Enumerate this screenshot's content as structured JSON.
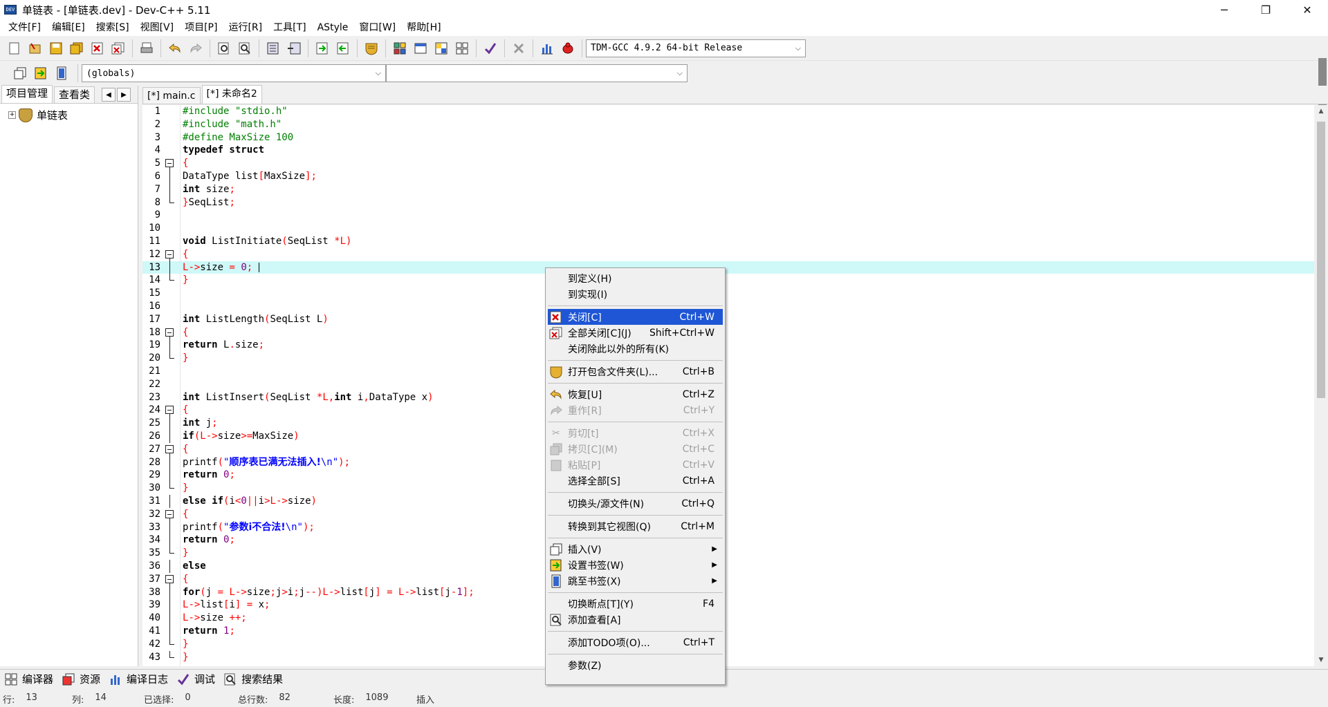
{
  "window": {
    "title": "单链表 - [单链表.dev] - Dev-C++ 5.11",
    "icon_text": "DEV",
    "minimize": "─",
    "restore": "❐",
    "close": "✕"
  },
  "menu": [
    "文件[F]",
    "编辑[E]",
    "搜索[S]",
    "视图[V]",
    "项目[P]",
    "运行[R]",
    "工具[T]",
    "AStyle",
    "窗口[W]",
    "帮助[H]"
  ],
  "toolbar": {
    "compiler_select": "TDM-GCC 4.9.2 64-bit Release",
    "scope_select": "(globals)",
    "symbol_select": ""
  },
  "left_panel": {
    "tabs": [
      "项目管理",
      "查看类"
    ],
    "nav_prev": "◀",
    "nav_next": "▶",
    "project": "单链表"
  },
  "editor_tabs": [
    "[*] main.c",
    "[*] 未命名2"
  ],
  "code_lines": [
    {
      "n": "1"
    },
    {
      "n": "2"
    },
    {
      "n": "3"
    },
    {
      "n": "4"
    },
    {
      "n": "5"
    },
    {
      "n": "6"
    },
    {
      "n": "7"
    },
    {
      "n": "8"
    },
    {
      "n": "9"
    },
    {
      "n": "10"
    },
    {
      "n": "11"
    },
    {
      "n": "12"
    },
    {
      "n": "13"
    },
    {
      "n": "14"
    },
    {
      "n": "15"
    },
    {
      "n": "16"
    },
    {
      "n": "17"
    },
    {
      "n": "18"
    },
    {
      "n": "19"
    },
    {
      "n": "20"
    },
    {
      "n": "21"
    },
    {
      "n": "22"
    },
    {
      "n": "23"
    },
    {
      "n": "24"
    },
    {
      "n": "25"
    },
    {
      "n": "26"
    },
    {
      "n": "27"
    },
    {
      "n": "28"
    },
    {
      "n": "29"
    },
    {
      "n": "30"
    },
    {
      "n": "31"
    },
    {
      "n": "32"
    },
    {
      "n": "33"
    },
    {
      "n": "34"
    },
    {
      "n": "35"
    },
    {
      "n": "36"
    },
    {
      "n": "37"
    },
    {
      "n": "38"
    },
    {
      "n": "39"
    },
    {
      "n": "40"
    },
    {
      "n": "41"
    },
    {
      "n": "42"
    },
    {
      "n": "43"
    }
  ],
  "code": {
    "l1": "#include \"stdio.h\"",
    "l2": "#include \"math.h\"",
    "l3": "#define MaxSize 100",
    "l4": "typedef struct",
    "l5": "{",
    "l6a": "DataType list",
    "l6b": "[",
    "l6c": "MaxSize",
    "l6d": "];",
    "l7a": "int",
    "l7b": " size",
    "l7c": ";",
    "l8a": "}",
    "l8b": "SeqList",
    "l8c": ";",
    "l11a": "void",
    "l11b": " ListInitiate",
    "l11c": "(",
    "l11d": "SeqList ",
    "l11e": "*",
    "l11f": "L",
    "l11g": ")",
    "l12": "{",
    "l13a": "L",
    "l13b": "->",
    "l13c": "size ",
    "l13d": "=",
    "l13e": " 0",
    "l13f": "; ",
    "l14": "}",
    "l17a": "int",
    "l17b": " ListLength",
    "l17c": "(",
    "l17d": "SeqList L",
    "l17e": ")",
    "l18": "{",
    "l19a": "return",
    "l19b": " L",
    "l19c": ".",
    "l19d": "size",
    "l19e": ";",
    "l20": "}",
    "l23a": "int",
    "l23b": " ListInsert",
    "l23c": "(",
    "l23d": "SeqList ",
    "l23e": "*",
    "l23f": "L",
    "l23g": ",",
    "l23h": "int",
    "l23i": " i",
    "l23j": ",",
    "l23k": "DataType x",
    "l23l": ")",
    "l24": "{",
    "l25a": "int",
    "l25b": " j",
    "l25c": ";",
    "l26a": "if",
    "l26b": "(",
    "l26c": "L",
    "l26d": "->",
    "l26e": "size",
    "l26f": ">=",
    "l26g": "MaxSize",
    "l26h": ")",
    "l27": "{",
    "l28a": "printf",
    "l28b": "(",
    "l28c": "\"",
    "l28d": "顺序表已满无法插入!",
    "l28e": "\\n\"",
    "l28f": ");",
    "l29a": "return",
    "l29b": " 0",
    "l29c": ";",
    "l30": "}",
    "l31a": "else if",
    "l31b": "(",
    "l31c": "i",
    "l31d": "<",
    "l31e": "0",
    "l31f": "||",
    "l31g": "i",
    "l31h": ">",
    "l31i": "L",
    "l31j": "->",
    "l31k": "size",
    "l31l": ")",
    "l32": "{",
    "l33a": "printf",
    "l33b": "(",
    "l33c": "\"",
    "l33d": "参数i不合法!",
    "l33e": "\\n\"",
    "l33f": ");",
    "l34a": "return",
    "l34b": " 0",
    "l34c": ";",
    "l35": "}",
    "l36": "else",
    "l37": "{",
    "l38a": "for",
    "l38b": "(",
    "l38c": "j ",
    "l38d": "=",
    "l38e": " L",
    "l38f": "->",
    "l38g": "size",
    "l38h": ";",
    "l38i": "j",
    "l38j": ">",
    "l38k": "i",
    "l38l": ";",
    "l38m": "j",
    "l38n": "--)",
    "l38o": "L",
    "l38p": "->",
    "l38q": "list",
    "l38r": "[",
    "l38s": "j",
    "l38t": "] = ",
    "l38u": "L",
    "l38v": "->",
    "l38w": "list",
    "l38x": "[",
    "l38y": "j",
    "l38z": "-",
    "l38aa": "1",
    "l38ab": "];",
    "l39a": "L",
    "l39b": "->",
    "l39c": "list",
    "l39d": "[",
    "l39e": "i",
    "l39f": "] = ",
    "l39g": "x",
    "l39h": ";",
    "l40a": "L",
    "l40b": "->",
    "l40c": "size ",
    "l40d": "++;",
    "l41a": "return",
    "l41b": " 1",
    "l41c": ";",
    "l42": "}",
    "l43": "}"
  },
  "context_menu": {
    "goto_def": "到定义(H)",
    "goto_impl": "到实现(I)",
    "close": "关闭[C]",
    "close_sc": "Ctrl+W",
    "close_all": "全部关闭[C](J)",
    "close_all_sc": "Shift+Ctrl+W",
    "close_others": "关闭除此以外的所有(K)",
    "open_folder": "打开包含文件夹(L)...",
    "open_folder_sc": "Ctrl+B",
    "undo": "恢复[U]",
    "undo_sc": "Ctrl+Z",
    "redo": "重作[R]",
    "redo_sc": "Ctrl+Y",
    "cut": "剪切[t]",
    "cut_sc": "Ctrl+X",
    "copy": "拷贝[C](M)",
    "copy_sc": "Ctrl+C",
    "paste": "粘贴[P]",
    "paste_sc": "Ctrl+V",
    "select_all": "选择全部[S]",
    "select_all_sc": "Ctrl+A",
    "toggle_header": "切换头/源文件(N)",
    "toggle_header_sc": "Ctrl+Q",
    "swap_view": "转换到其它视图(Q)",
    "swap_view_sc": "Ctrl+M",
    "insert": "插入(V)",
    "set_bookmark": "设置书签(W)",
    "goto_bookmark": "跳至书签(X)",
    "toggle_breakpoint": "切换断点[T](Y)",
    "toggle_breakpoint_sc": "F4",
    "add_watch": "添加查看[A]",
    "add_todo": "添加TODO项(O)...",
    "add_todo_sc": "Ctrl+T",
    "params": "参数(Z)",
    "highlight_color": "#1e56d6"
  },
  "bottom_tabs": [
    "编译器",
    "资源",
    "编译日志",
    "调试",
    "搜索结果"
  ],
  "status": {
    "row_label": "行:",
    "row": "13",
    "col_label": "列:",
    "col": "14",
    "sel_label": "已选择:",
    "sel": "0",
    "total_label": "总行数:",
    "total": "82",
    "len_label": "长度:",
    "len": "1089",
    "mode": "插入"
  },
  "colors": {
    "current_line": "#cff8f8",
    "preprocessor": "#008000",
    "symbol": "#ff0000",
    "number": "#800080",
    "string": "#0000ff"
  }
}
